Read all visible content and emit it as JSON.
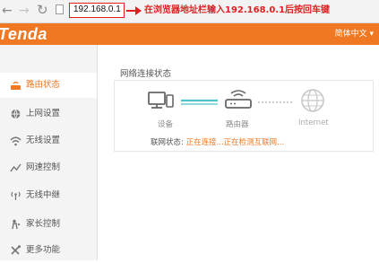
{
  "browser": {
    "url": "192.168.0.1",
    "annotation": "在浏览器地址栏输入192.168.0.1后按回车键"
  },
  "header": {
    "logo": "Tenda",
    "language": "简体中文"
  },
  "sidebar": {
    "items": [
      {
        "label": "路由状态",
        "icon": "router-status-icon",
        "active": true
      },
      {
        "label": "上网设置",
        "icon": "globe-icon"
      },
      {
        "label": "无线设置",
        "icon": "wifi-icon"
      },
      {
        "label": "网速控制",
        "icon": "speed-control-icon"
      },
      {
        "label": "无线中继",
        "icon": "wireless-repeater-icon"
      },
      {
        "label": "家长控制",
        "icon": "parental-control-icon"
      },
      {
        "label": "更多功能",
        "icon": "tools-icon"
      }
    ]
  },
  "main": {
    "section_title": "网络连接状态",
    "devices": {
      "device_label": "设备",
      "router_label": "路由器",
      "internet_label": "Internet"
    },
    "status": {
      "label": "联网状态:",
      "value": "正在连接...正在检测互联网..."
    }
  },
  "colors": {
    "brand": "#f07822",
    "annotation": "#e02020",
    "link_line": "#4fc3c8"
  }
}
